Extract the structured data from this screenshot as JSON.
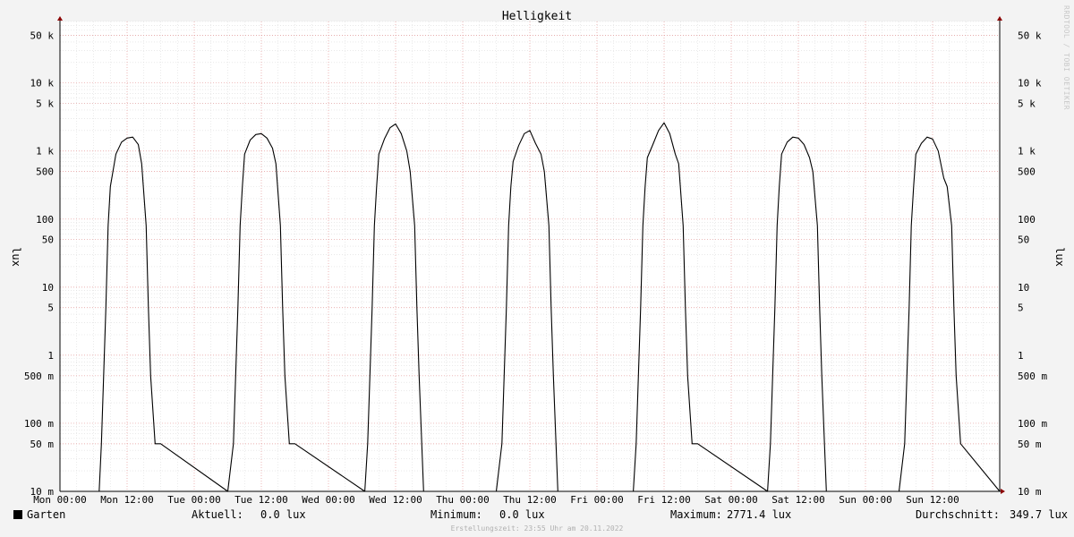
{
  "chart_data": {
    "type": "line",
    "title": "Helligkeit",
    "ylabel": "lux",
    "y_scale": "log",
    "ylim": [
      0.01,
      80000
    ],
    "y_ticks": [
      {
        "value": 50000,
        "label": "50 k"
      },
      {
        "value": 10000,
        "label": "10 k"
      },
      {
        "value": 5000,
        "label": "5 k"
      },
      {
        "value": 1000,
        "label": "1 k"
      },
      {
        "value": 500,
        "label": "500"
      },
      {
        "value": 100,
        "label": "100"
      },
      {
        "value": 50,
        "label": "50"
      },
      {
        "value": 10,
        "label": "10"
      },
      {
        "value": 5,
        "label": "5"
      },
      {
        "value": 1,
        "label": "1"
      },
      {
        "value": 0.5,
        "label": "500 m"
      },
      {
        "value": 0.1,
        "label": "100 m"
      },
      {
        "value": 0.05,
        "label": "50 m"
      },
      {
        "value": 0.01,
        "label": "10 m"
      }
    ],
    "x_ticks": [
      "Mon 00:00",
      "Mon 12:00",
      "Tue 00:00",
      "Tue 12:00",
      "Wed 00:00",
      "Wed 12:00",
      "Thu 00:00",
      "Thu 12:00",
      "Fri 00:00",
      "Fri 12:00",
      "Sat 00:00",
      "Sat 12:00",
      "Sun 00:00",
      "Sun 12:00"
    ],
    "grid": true,
    "series": [
      {
        "name": "Garten",
        "color": "#000000",
        "x_hours": [
          0,
          7.0,
          7.4,
          7.8,
          8.2,
          8.6,
          9.0,
          10.0,
          11.0,
          12.0,
          13.0,
          14.0,
          14.6,
          15.4,
          15.8,
          16.2,
          17.0,
          18.0,
          30.0,
          31.0,
          31.4,
          31.8,
          32.2,
          32.6,
          33.0,
          34.0,
          35.0,
          36.0,
          37.0,
          38.0,
          38.6,
          39.4,
          39.8,
          40.2,
          41.0,
          42.0,
          54.5,
          55.0,
          55.4,
          55.8,
          56.2,
          56.6,
          57.0,
          58.0,
          59.0,
          60.0,
          61.0,
          62.0,
          62.6,
          63.4,
          63.8,
          64.2,
          65.0,
          78.0,
          79.0,
          79.4,
          79.8,
          80.2,
          80.6,
          81.0,
          82.0,
          83.0,
          84.0,
          85.0,
          86.0,
          86.6,
          87.4,
          87.8,
          88.2,
          89.0,
          90.0,
          102.5,
          103.0,
          103.4,
          103.8,
          104.2,
          104.6,
          105.0,
          106.0,
          107.0,
          108.0,
          109.0,
          110.0,
          110.6,
          111.4,
          111.8,
          112.2,
          113.0,
          114.0,
          126.5,
          127.0,
          127.4,
          127.8,
          128.2,
          128.6,
          129.0,
          130.0,
          131.0,
          132.0,
          133.0,
          134.0,
          134.6,
          135.4,
          135.8,
          136.2,
          137.0,
          138.0,
          150.0,
          151.0,
          151.4,
          151.8,
          152.2,
          152.6,
          153.0,
          154.0,
          155.0,
          156.0,
          157.0,
          158.0,
          158.6,
          159.4,
          159.8,
          160.2,
          161.0,
          168.0
        ],
        "y_lux": [
          0.01,
          0.01,
          0.05,
          0.5,
          5,
          80,
          300,
          900,
          1350,
          1550,
          1600,
          1250,
          650,
          80,
          5,
          0.5,
          0.05,
          0.05,
          0.01,
          0.05,
          0.5,
          5,
          80,
          300,
          900,
          1450,
          1750,
          1800,
          1550,
          1100,
          650,
          80,
          5,
          0.5,
          0.05,
          0.05,
          0.01,
          0.05,
          0.5,
          5,
          80,
          300,
          900,
          1500,
          2200,
          2500,
          1800,
          1000,
          500,
          80,
          5,
          0.5,
          0.01,
          0.01,
          0.05,
          0.5,
          5,
          80,
          300,
          700,
          1200,
          1800,
          2000,
          1300,
          900,
          500,
          80,
          5,
          0.5,
          0.01,
          0.01,
          0.01,
          0.05,
          0.5,
          5,
          80,
          300,
          800,
          1250,
          2000,
          2600,
          1800,
          900,
          650,
          80,
          5,
          0.5,
          0.05,
          0.05,
          0.01,
          0.05,
          0.5,
          5,
          80,
          300,
          900,
          1350,
          1600,
          1550,
          1250,
          800,
          500,
          80,
          5,
          0.5,
          0.01,
          0.01,
          0.01,
          0.05,
          0.5,
          5,
          80,
          300,
          900,
          1300,
          1600,
          1500,
          1000,
          400,
          300,
          80,
          5,
          0.5,
          0.05,
          0.01
        ]
      }
    ]
  },
  "legend": {
    "label": "Garten"
  },
  "stats": {
    "current_label": "Aktuell:",
    "current_value": "0.0 lux",
    "min_label": "Minimum:",
    "min_value": "0.0 lux",
    "max_label": "Maximum:",
    "max_value": "2771.4 lux",
    "avg_label": "Durchschnitt:",
    "avg_value": "349.7 lux"
  },
  "creation_note": "Erstellungszeit: 23:55 Uhr am 20.11.2022",
  "vendor_label": "RRDTOOL / TOBI OETIKER"
}
